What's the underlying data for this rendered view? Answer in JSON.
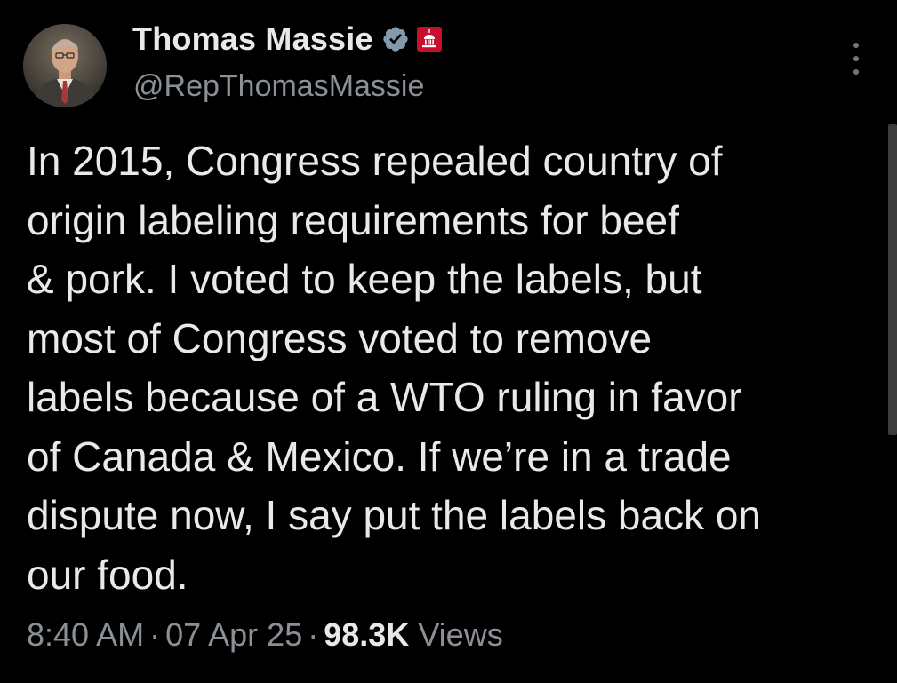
{
  "author": {
    "display_name": "Thomas Massie",
    "handle": "@RepThomasMassie",
    "verified_badge_icon": "verified-checkmark-icon",
    "affiliation_badge_icon": "us-capitol-icon",
    "colors": {
      "verified_badge": "#829aab",
      "affiliation_badge": "#c8102e"
    }
  },
  "tweet": {
    "text_lines": [
      "In 2015, Congress repealed country of",
      "origin labeling requirements for beef",
      "& pork. I voted to keep the labels, but",
      "most of Congress voted to remove",
      "labels because of a WTO ruling in favor",
      "of Canada & Mexico. If we’re in a trade",
      "dispute now, I say put the labels back on",
      "our food."
    ]
  },
  "meta": {
    "time": "8:40 AM",
    "separator": "·",
    "date": "07 Apr 25",
    "views_count": "98.3K",
    "views_label": "Views"
  },
  "more_button_icon": "more-vertical-icon"
}
